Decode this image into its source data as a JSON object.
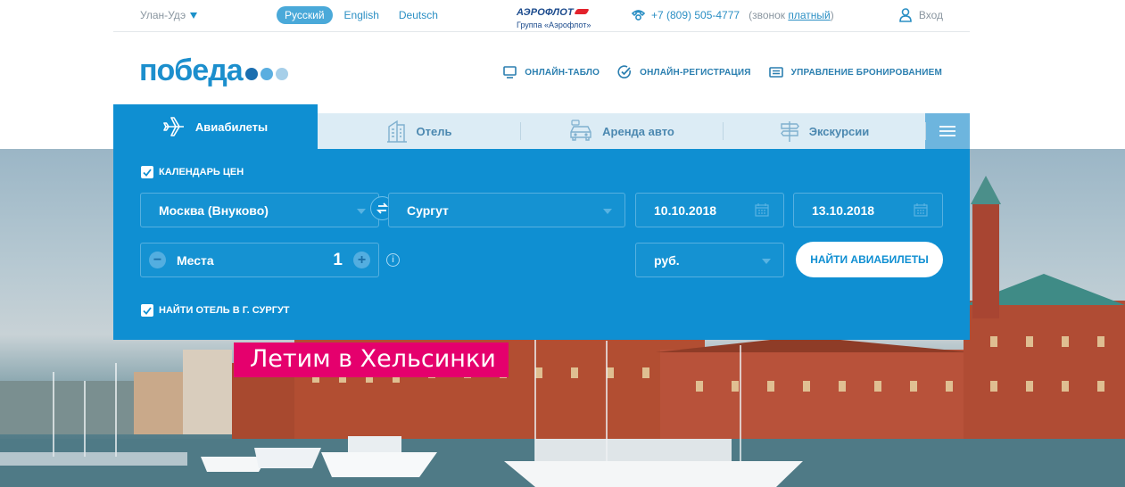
{
  "topbar": {
    "city": "Улан-Удэ",
    "languages": [
      "Русский",
      "English",
      "Deutsch"
    ],
    "aeroflot_brand": "АЭРОФЛОТ",
    "aeroflot_group": "Группа «Аэрофлот»",
    "phone": "+7 (809) 505-4777",
    "phone_note_prefix": "(звонок ",
    "phone_note_link": "платный",
    "phone_note_suffix": ")",
    "login": "Вход"
  },
  "logo": {
    "text": "победа"
  },
  "nav": {
    "board": "Онлайн-табло",
    "checkin": "Онлайн-регистрация",
    "booking": "Управление бронированием"
  },
  "tabs": {
    "flights": "Авиабилеты",
    "hotel": "Отель",
    "car": "Аренда авто",
    "excursions": "Экскурсии"
  },
  "search": {
    "price_calendar": "Календарь цен",
    "origin": "Москва (Внуково)",
    "destination": "Сургут",
    "date_out": "10.10.2018",
    "date_back": "13.10.2018",
    "seats_label": "Места",
    "seats_value": "1",
    "currency": "руб.",
    "find_button": "Найти авиабилеты",
    "find_hotel": "Найти отель в г. Сургут"
  },
  "promo": {
    "text": "Летим в Хельсинки"
  },
  "colors": {
    "primary": "#0f8fd2",
    "link": "#2b8fc4",
    "promo": "#e5006d",
    "logo_dots": [
      "#1c6fb0",
      "#5aaee0",
      "#a6cfe9"
    ]
  }
}
